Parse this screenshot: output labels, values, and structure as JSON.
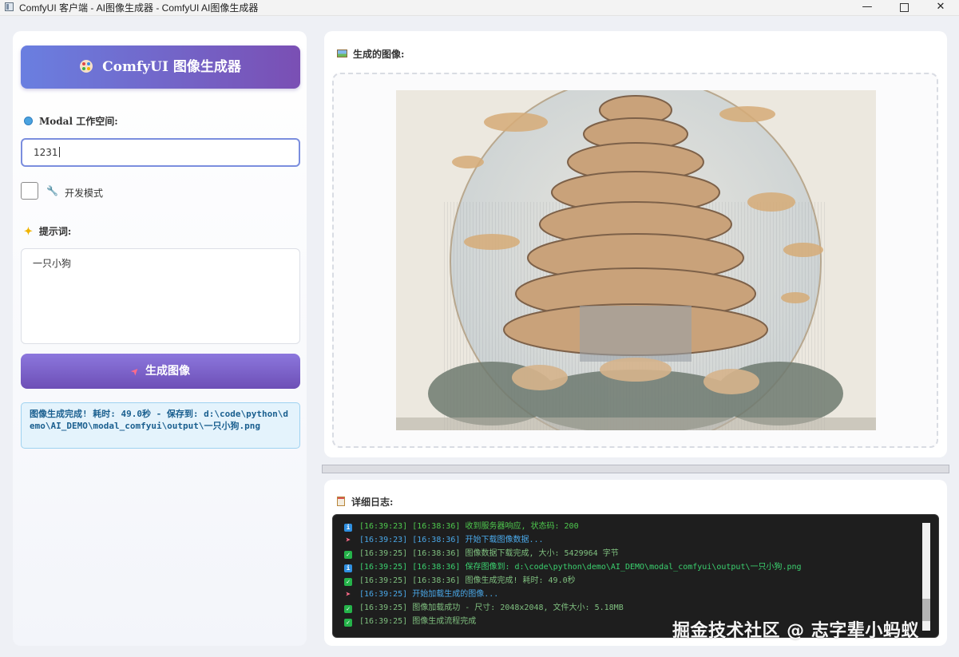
{
  "window": {
    "title": "ComfyUI 客户端 - AI图像生成器 - ComfyUI AI图像生成器",
    "minimize_glyph": "—",
    "close_glyph": "✕"
  },
  "sidebar": {
    "header_title": "ComfyUI 图像生成器",
    "workspace_label": "Modal 工作空间:",
    "workspace_value": "1231",
    "dev_mode_label": "开发模式",
    "dev_mode_checked": false,
    "prompt_label": "提示词:",
    "prompt_value": "一只小狗",
    "generate_label": "生成图像",
    "status_text": "图像生成完成! 耗时: 49.0秒 - 保存到: d:\\code\\python\\demo\\AI_DEMO\\modal_comfyui\\output\\一只小狗.png"
  },
  "image_panel": {
    "title": "生成的图像:"
  },
  "log_panel": {
    "title": "详细日志:",
    "lines": [
      {
        "icon": "info",
        "text": "[16:39:23] [16:38:36] 收到服务器响应, 状态码: 200"
      },
      {
        "icon": "rocket",
        "text": "[16:39:23] [16:38:36] 开始下载图像数据..."
      },
      {
        "icon": "ok",
        "text": "[16:39:25] [16:38:36] 图像数据下载完成, 大小: 5429964 字节"
      },
      {
        "icon": "info",
        "text": "[16:39:25] [16:38:36] 保存图像到: d:\\code\\python\\demo\\AI_DEMO\\modal_comfyui\\output\\一只小狗.png"
      },
      {
        "icon": "ok",
        "text": "[16:39:25] [16:38:36] 图像生成完成! 耗时: 49.0秒"
      },
      {
        "icon": "rocket",
        "text": "[16:39:25] 开始加载生成的图像..."
      },
      {
        "icon": "ok",
        "text": "[16:39:25] 图像加载成功 - 尺寸: 2048x2048, 文件大小: 5.18MB"
      },
      {
        "icon": "ok",
        "text": "[16:39:25] 图像生成流程完成"
      }
    ]
  },
  "watermark": "掘金技术社区 @ 志字辈小蚂蚁",
  "colors": {
    "accent_start": "#6a7fe0",
    "accent_end": "#7a4fb4",
    "status_bg": "#e4f3fc",
    "log_bg": "#1e1e1e"
  }
}
